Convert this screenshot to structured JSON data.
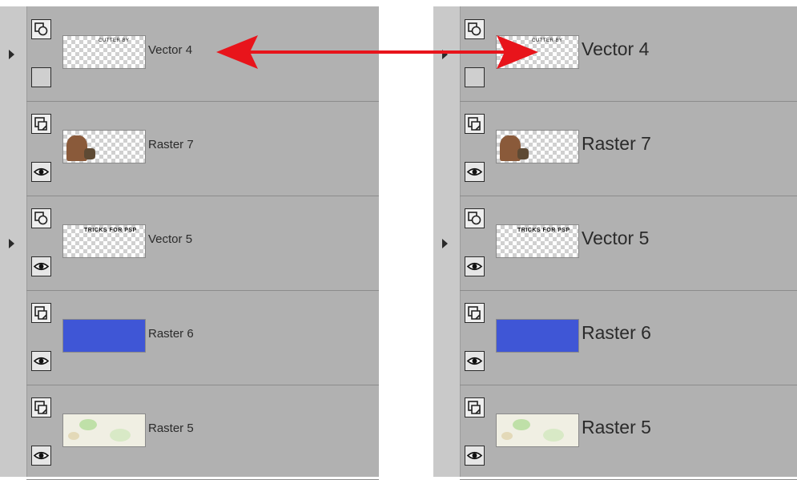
{
  "panels": {
    "left": {
      "layers": [
        {
          "name": "Vector 4",
          "type": "vector",
          "visible": false,
          "expandable": true,
          "thumb_text": "CUTTER BY"
        },
        {
          "name": "Raster 7",
          "type": "raster",
          "visible": true,
          "expandable": false,
          "thumb_kind": "figure"
        },
        {
          "name": "Vector 5",
          "type": "vector",
          "visible": true,
          "expandable": true,
          "thumb_text": "TRICKS FOR PSP"
        },
        {
          "name": "Raster 6",
          "type": "raster",
          "visible": true,
          "expandable": false,
          "thumb_kind": "solid",
          "thumb_color": "#3f56d6"
        },
        {
          "name": "Raster 5",
          "type": "raster",
          "visible": true,
          "expandable": false,
          "thumb_kind": "map"
        }
      ]
    },
    "right": {
      "layers": [
        {
          "name": "Vector 4",
          "type": "vector",
          "visible": false,
          "expandable": true,
          "thumb_text": "CUTTER BY"
        },
        {
          "name": "Raster 7",
          "type": "raster",
          "visible": true,
          "expandable": false,
          "thumb_kind": "figure"
        },
        {
          "name": "Vector 5",
          "type": "vector",
          "visible": true,
          "expandable": true,
          "thumb_text": "TRICKS FOR PSP"
        },
        {
          "name": "Raster 6",
          "type": "raster",
          "visible": true,
          "expandable": false,
          "thumb_kind": "solid",
          "thumb_color": "#3f56d6"
        },
        {
          "name": "Raster 5",
          "type": "raster",
          "visible": true,
          "expandable": false,
          "thumb_kind": "map"
        }
      ]
    }
  },
  "annotation": {
    "arrow_color": "#e8141b",
    "arrow_icon": "double-headed-arrow"
  },
  "colors": {
    "panel_bg": "#b1b1b1",
    "gutter_bg": "#c9c9c9",
    "raster6_fill": "#3f56d6"
  }
}
